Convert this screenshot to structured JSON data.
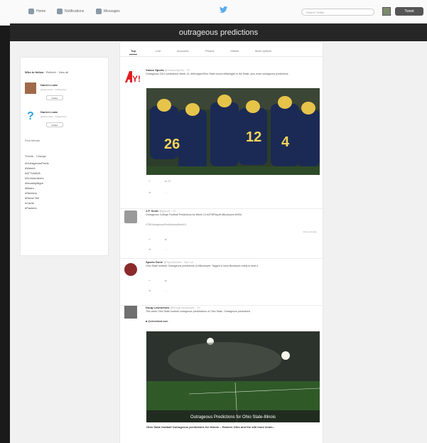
{
  "nav": {
    "home": "Home",
    "notifications": "Notifications",
    "messages": "Messages",
    "search_placeholder": "Search Twitter",
    "tweet_button": "Tweet"
  },
  "search": {
    "query": "outrageous predictions"
  },
  "tabs": [
    "Top",
    "Live",
    "Accounts",
    "Photos",
    "Videos",
    "More options"
  ],
  "sidebar": {
    "who_to_follow": "Who to follow",
    "refresh": "Refresh",
    "view_all": "View all",
    "suggestions": [
      {
        "name": "Darren Lowe",
        "handle": "@darrenlowe · Followed by",
        "follow": "Follow"
      },
      {
        "name": "Darren Lowe",
        "handle": "@darrenlowe · Followed by",
        "follow": "Follow"
      }
    ],
    "find_people": "Find friends",
    "trends_title": "Trends · Change",
    "trends": [
      "#OutrageousPreds",
      "#Week4",
      "#ATTvsMLB",
      "#GoVolunteers",
      "#MondayNight",
      "#Bears",
      "#Steelers",
      "#Rebel Yell",
      "#Cards",
      "#Packers"
    ]
  },
  "tweets": [
    {
      "name": "Yahoo Sports",
      "handle": "@YahooSports · 7h",
      "text": "Outrageous 2014 predictions Week 13: #Michigan/Ohio State bound #Michigan in the finale, plus more outrageous predictions",
      "replies": "",
      "retweets": "25",
      "favorites": "",
      "logo": "Y!"
    },
    {
      "name": "J.P. Scott",
      "handle": "@jpscott · 7h",
      "text": "Outrageous College Football Predictions for Week 13 #CFBPlayoff #Buckeyes #MSU",
      "text2": "CFBOutrageousPredictionsWeek13",
      "view": "View summary",
      "replies": "",
      "retweets": "",
      "favorites": ""
    },
    {
      "name": "Sports Gone",
      "handle": "@SportsGone · Nov 14",
      "text": "Ohio State football: Outrageous predictions of #Buckeyes' Tagged & Iowa Buckeyes ready to beat #",
      "replies": "",
      "retweets": "",
      "favorites": ""
    },
    {
      "name": "Doug Lesmerises",
      "handle": "@DougLesmerises · 7h",
      "text": "This week Ohio State football outrageous preddictions of Ohio State, Outrageous predictions",
      "text2": "@cleveland.com",
      "caption": "Ohio State football Outrageous predictions for Illinois -- Eastern Ohio and the still more kinds...",
      "overlay": "Outrageous Predictions for Ohio State-Illinois"
    }
  ],
  "colors": {
    "accent": "#55acee",
    "dark": "#262626"
  }
}
